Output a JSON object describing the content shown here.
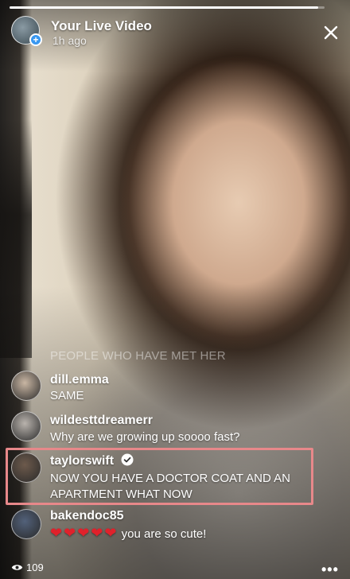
{
  "header": {
    "title": "Your Live Video",
    "time_ago": "1h ago",
    "plus_glyph": "+"
  },
  "progress_fraction": 0.98,
  "comments": {
    "faded_text": "PEOPLE WHO HAVE MET HER",
    "items": [
      {
        "username": "dill.emma",
        "text": "SAME",
        "avatar_color": "#c9b6a3"
      },
      {
        "username": "wildesttdreamerr",
        "text": "Why are we growing up soooo fast?",
        "avatar_color": "#b9b3ad"
      },
      {
        "username": "taylorswift",
        "verified": true,
        "text": "NOW YOU HAVE A DOCTOR COAT AND AN APARTMENT WHAT NOW",
        "avatar_color": "#6d5a4c"
      },
      {
        "username": "bakendoc85",
        "text": "you are so cute!",
        "heart_count": 5,
        "avatar_color": "#52617a"
      }
    ]
  },
  "footer": {
    "viewer_count": "109",
    "more_glyph": "•••"
  },
  "colors": {
    "highlight": "#e7888a",
    "heart": "#e0212b",
    "verified": "#ffffff",
    "badge": "#3897f0"
  },
  "icons": {
    "close": "close-icon",
    "eye": "eye-icon",
    "verified": "verified-badge-icon",
    "more": "more-options-icon"
  }
}
